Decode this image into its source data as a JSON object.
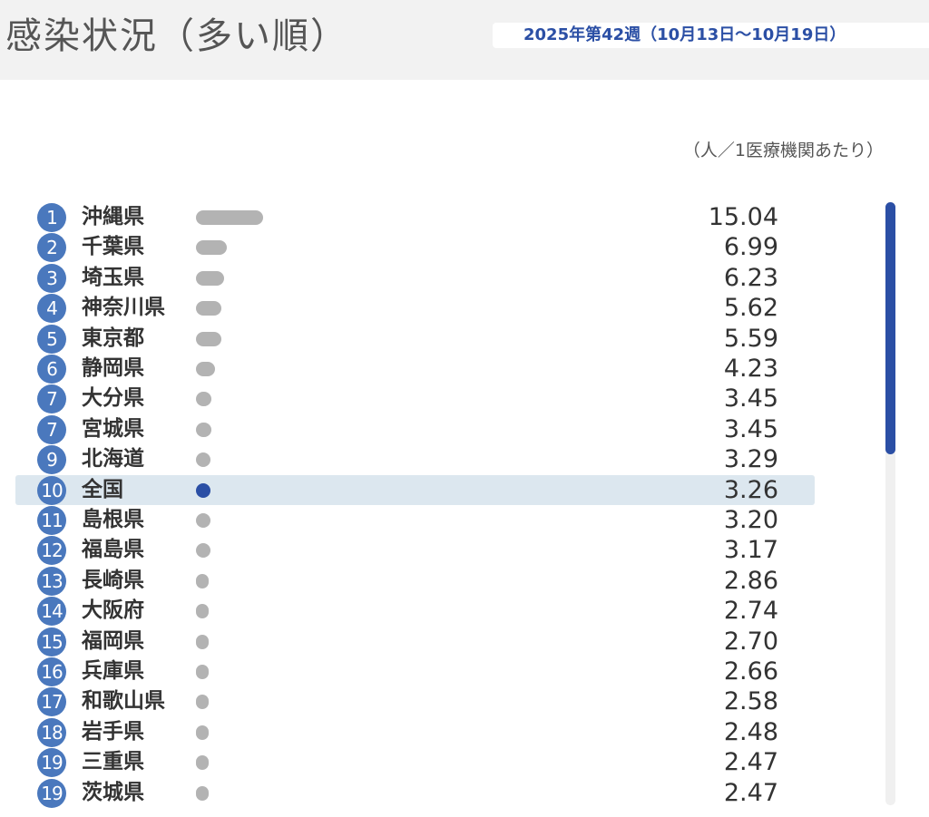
{
  "header": {
    "title": "感染状況（多い順）",
    "week": "2025年第42週（10月13日〜10月19日）"
  },
  "unit": "（人／1医療機関あたり）",
  "colors": {
    "bar": "#b3b3b3",
    "national_bar": "#2b4fa5",
    "rank_badge": "#4a78bd",
    "highlight_row": "#dce7ef"
  },
  "chart_data": {
    "type": "bar",
    "orientation": "horizontal",
    "title": "感染状況（多い順）",
    "subtitle": "2025年第42週（10月13日〜10月19日）",
    "unit_label": "（人／1医療機関あたり）",
    "highlight": "全国",
    "rows": [
      {
        "rank": "1",
        "name": "沖縄県",
        "value": 15.04,
        "label": "15.04"
      },
      {
        "rank": "2",
        "name": "千葉県",
        "value": 6.99,
        "label": "6.99"
      },
      {
        "rank": "3",
        "name": "埼玉県",
        "value": 6.23,
        "label": "6.23"
      },
      {
        "rank": "4",
        "name": "神奈川県",
        "value": 5.62,
        "label": "5.62"
      },
      {
        "rank": "5",
        "name": "東京都",
        "value": 5.59,
        "label": "5.59"
      },
      {
        "rank": "6",
        "name": "静岡県",
        "value": 4.23,
        "label": "4.23"
      },
      {
        "rank": "7",
        "name": "大分県",
        "value": 3.45,
        "label": "3.45"
      },
      {
        "rank": "7",
        "name": "宮城県",
        "value": 3.45,
        "label": "3.45"
      },
      {
        "rank": "9",
        "name": "北海道",
        "value": 3.29,
        "label": "3.29"
      },
      {
        "rank": "10",
        "name": "全国",
        "value": 3.26,
        "label": "3.26"
      },
      {
        "rank": "11",
        "name": "島根県",
        "value": 3.2,
        "label": "3.20"
      },
      {
        "rank": "12",
        "name": "福島県",
        "value": 3.17,
        "label": "3.17"
      },
      {
        "rank": "13",
        "name": "長崎県",
        "value": 2.86,
        "label": "2.86"
      },
      {
        "rank": "14",
        "name": "大阪府",
        "value": 2.74,
        "label": "2.74"
      },
      {
        "rank": "15",
        "name": "福岡県",
        "value": 2.7,
        "label": "2.70"
      },
      {
        "rank": "16",
        "name": "兵庫県",
        "value": 2.66,
        "label": "2.66"
      },
      {
        "rank": "17",
        "name": "和歌山県",
        "value": 2.58,
        "label": "2.58"
      },
      {
        "rank": "18",
        "name": "岩手県",
        "value": 2.48,
        "label": "2.48"
      },
      {
        "rank": "19",
        "name": "三重県",
        "value": 2.47,
        "label": "2.47"
      },
      {
        "rank": "19",
        "name": "茨城県",
        "value": 2.47,
        "label": "2.47"
      }
    ]
  }
}
